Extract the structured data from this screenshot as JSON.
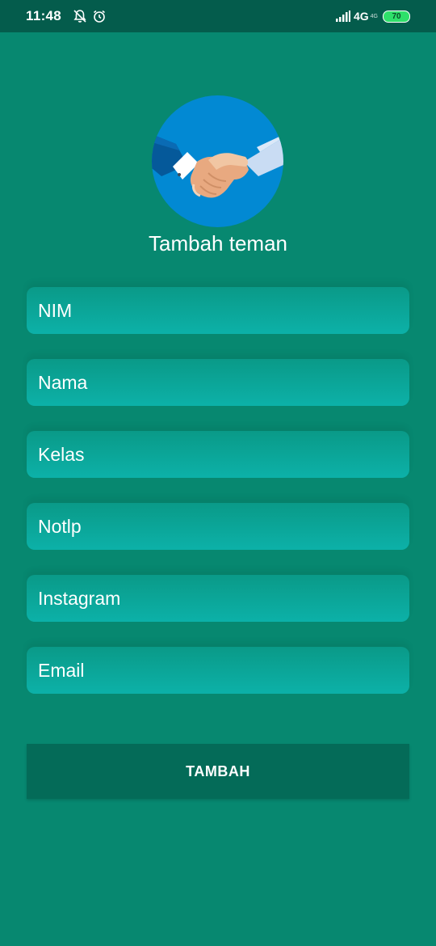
{
  "status_bar": {
    "time": "11:48",
    "network": "4G",
    "network_sub": "4G",
    "battery": "70",
    "icons": [
      "bell-muted-icon",
      "alarm-icon",
      "signal-icon",
      "battery-icon"
    ]
  },
  "header": {
    "logo_icon": "handshake-icon",
    "title": "Tambah teman"
  },
  "form": {
    "fields": [
      {
        "name": "nim",
        "placeholder": "NIM",
        "value": ""
      },
      {
        "name": "nama",
        "placeholder": "Nama",
        "value": ""
      },
      {
        "name": "kelas",
        "placeholder": "Kelas",
        "value": ""
      },
      {
        "name": "notlp",
        "placeholder": "Notlp",
        "value": ""
      },
      {
        "name": "instagram",
        "placeholder": "Instagram",
        "value": ""
      },
      {
        "name": "email",
        "placeholder": "Email",
        "value": ""
      }
    ],
    "submit_label": "TAMBAH"
  },
  "colors": {
    "background": "#078870",
    "status_bar": "#045c4c",
    "field_top": "#0a9a88",
    "field_bottom": "#0cb1a8",
    "button": "#046b58",
    "logo_circle": "#0289d3"
  }
}
